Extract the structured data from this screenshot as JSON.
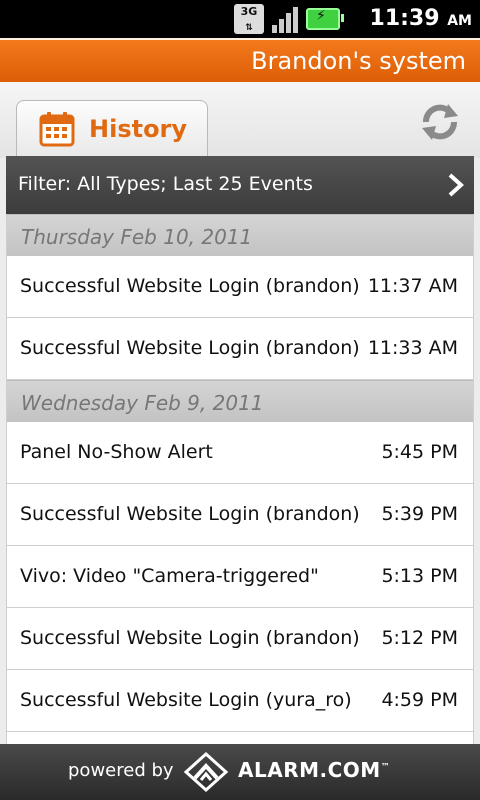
{
  "status_bar": {
    "network": "3G",
    "time": "11:39",
    "ampm": "AM",
    "icons": [
      "3g-icon",
      "signal-icon",
      "battery-charging-icon"
    ]
  },
  "title_bar": {
    "title": "Brandon's system",
    "color": "#ee6e12"
  },
  "tab": {
    "label": "History",
    "icon": "calendar-icon",
    "accent": "#e06a12"
  },
  "refresh_icon": "refresh-icon",
  "filter": {
    "label": "Filter: All Types; Last 25 Events",
    "icon": "chevron-right-icon"
  },
  "groups": [
    {
      "date": "Thursday Feb 10, 2011",
      "events": [
        {
          "name": "Successful Website Login (brandon)",
          "time": "11:37 AM"
        },
        {
          "name": "Successful Website Login (brandon)",
          "time": "11:33 AM"
        }
      ]
    },
    {
      "date": "Wednesday Feb 9, 2011",
      "events": [
        {
          "name": "Panel No-Show Alert",
          "time": "5:45 PM"
        },
        {
          "name": "Successful Website Login (brandon)",
          "time": "5:39 PM"
        },
        {
          "name": "Vivo: Video \"Camera-triggered\"",
          "time": "5:13 PM"
        },
        {
          "name": "Successful Website Login (brandon)",
          "time": "5:12 PM"
        },
        {
          "name": "Successful Website Login (yura_ro)",
          "time": "4:59 PM"
        }
      ]
    }
  ],
  "footer": {
    "powered_by": "powered by",
    "brand": "ALARM.COM",
    "trademark": "™"
  }
}
